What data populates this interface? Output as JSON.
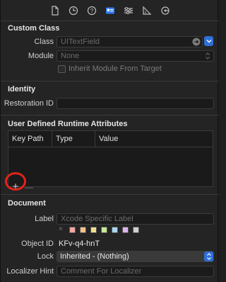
{
  "toolbar": {
    "icons": [
      "file-icon",
      "history-icon",
      "help-icon",
      "identity-icon",
      "attributes-icon",
      "size-icon",
      "connections-icon"
    ],
    "active": "identity-icon"
  },
  "custom_class": {
    "title": "Custom Class",
    "class_label": "Class",
    "class_placeholder": "UITextField",
    "module_label": "Module",
    "module_placeholder": "None",
    "inherit_label": "Inherit Module From Target"
  },
  "identity": {
    "title": "Identity",
    "restoration_id_label": "Restoration ID",
    "restoration_id_value": ""
  },
  "udra": {
    "title": "User Defined Runtime Attributes",
    "columns": [
      "Key Path",
      "Type",
      "Value"
    ],
    "add_label": "+",
    "remove_label": "—"
  },
  "document": {
    "title": "Document",
    "label_label": "Label",
    "label_placeholder": "Xcode Specific Label",
    "swatch_clear": "×",
    "swatches": [
      "#f2a7a0",
      "#f5c089",
      "#eee08f",
      "#c7e89a",
      "#a9d8f0",
      "#d8b8ef",
      "#d0d0d0"
    ],
    "object_id_label": "Object ID",
    "object_id_value": "KFv-q4-hnT",
    "lock_label": "Lock",
    "lock_value": "Inherited - (Nothing)",
    "localizer_label": "Localizer Hint",
    "localizer_placeholder": "Comment For Localizer"
  },
  "colors": {
    "accent": "#2f6fd8",
    "annotation": "#e2231a"
  }
}
